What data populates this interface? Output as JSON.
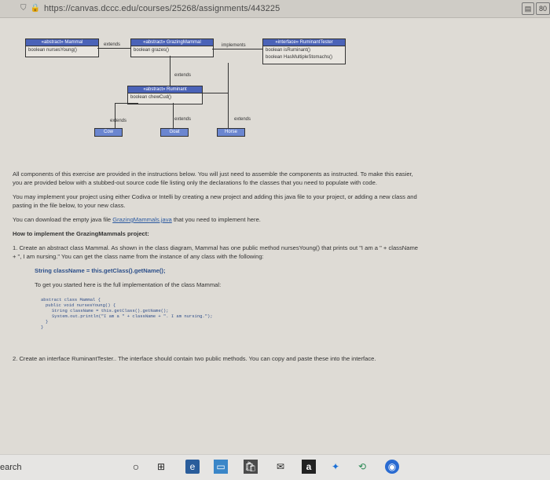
{
  "browser": {
    "url": "https://canvas.dccc.edu/courses/25268/assignments/443225",
    "right_icon_label": "80"
  },
  "uml": {
    "mammal": {
      "title": "«abstract» Mammal",
      "field": "boolean nursesYoung()"
    },
    "grazing": {
      "title": "«abstract» GrazingMammal",
      "field": "boolean grazes()"
    },
    "tester": {
      "title": "«interface» RuminantTester",
      "field1": "boolean isRuminant()",
      "field2": "boolean HasMultipleStomachs()"
    },
    "ruminant": {
      "title": "«abstract» Ruminant",
      "field": "boolean chewCud()"
    },
    "cow": "Cow",
    "goat": "Goat",
    "horse": "Horse",
    "extends1": "extends",
    "implements": "implements",
    "extends2": "extends",
    "extends3": "extends",
    "extends4": "extends",
    "extends5": "extends"
  },
  "instructions": {
    "p1": "All components of this exercise are provided in the instructions below. You will just need to assemble the components as instructed. To make this easier, you are provided below with a stubbed-out source code file listing only the declarations fo the classes that you need to populate with code.",
    "p2": "You may implement your project using either Codiva or Intelli by creating a new project and adding this java file to your project, or adding a new class and pasting in the file below, to your new class.",
    "p3_prefix": "You can download the empty java file ",
    "p3_link": "GrazingMammals.java",
    "p3_suffix": " that you need to implement here.",
    "heading": "How to implement the GrazingMammals project:",
    "item1": "1. Create an abstract class Mammal. As shown in the class diagram, Mammal has one public method nursesYoung() that prints out \"I am a \" + className + \", I am nursing.\" You can get the class name from the instance of any class with the following:",
    "code_line": "String className = this.getClass().getName();",
    "started": "To get you started here is the full implementation of the class Mammal:",
    "code": [
      "abstract class Mammal {",
      "    public void nursesYoung() {",
      "        String className = this.getClass().getName();",
      "        System.out.println(\"I am a \" + className + \". I am nursing.\");",
      "    }",
      "}"
    ],
    "item2": "2. Create an interface RuminantTester.. The interface should contain two public methods. You can copy and paste these into the interface."
  },
  "taskbar": {
    "search": "earch"
  }
}
